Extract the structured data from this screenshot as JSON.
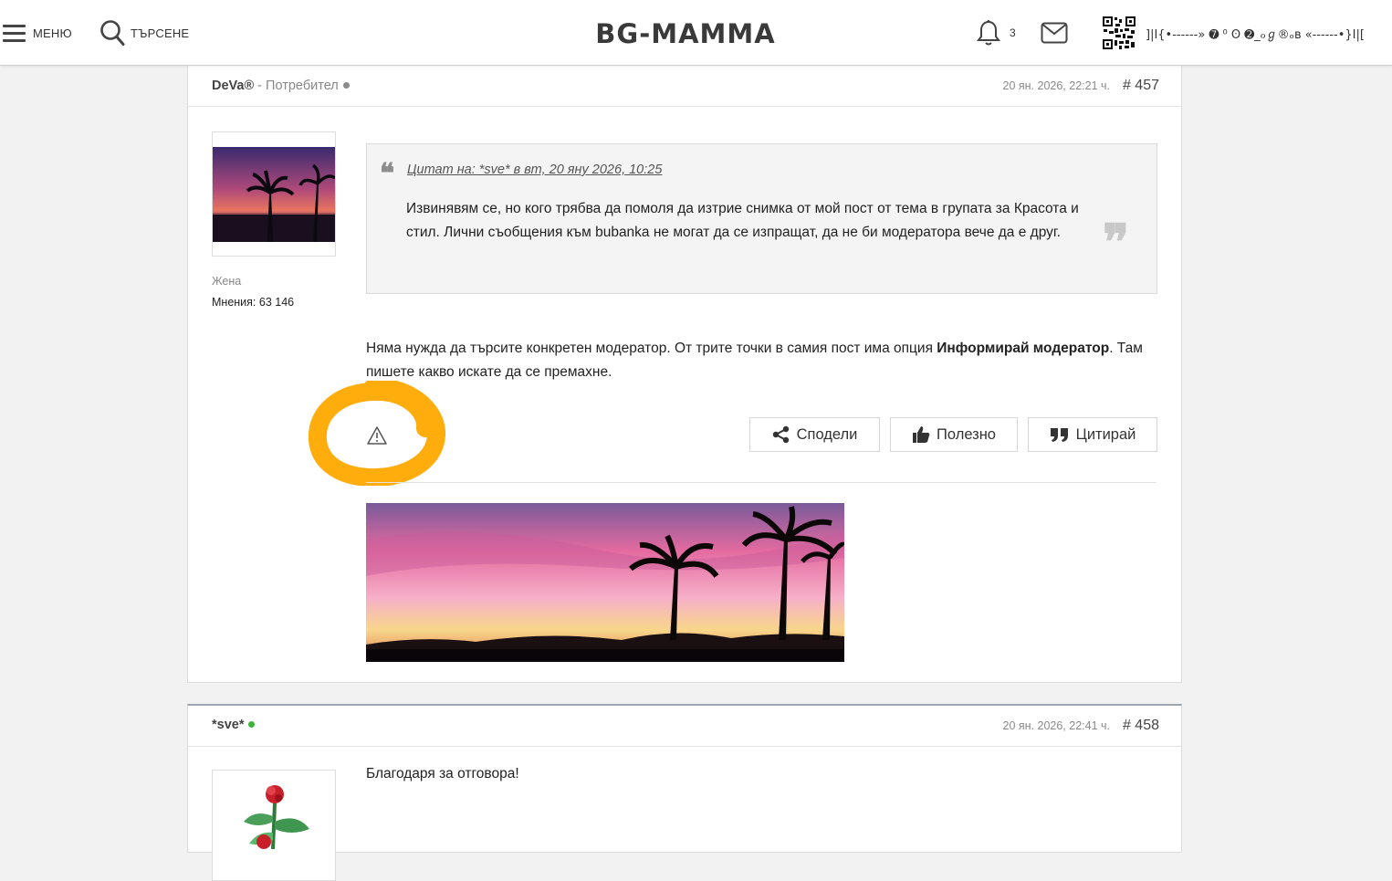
{
  "header": {
    "menu_label": "МЕНЮ",
    "search_label": "ТЪРСЕНЕ",
    "logo": "BG-MAMMA",
    "notifications_count": "3",
    "username": "]|I{•------» ➐ ⁰ ʘ ➋_ℴℊ®ₒʙ «------•}I|["
  },
  "post1": {
    "author": "DeVa®",
    "role": " - Потребител",
    "date": "20 ян. 2026, 22:21 ч.",
    "number": "# 457",
    "gender": "Жена",
    "opinions": "Мнения: 63 146",
    "quote": {
      "cite": "Цитат на: *sve* в вт, 20 яну 2026, 10:25",
      "text": "Извинявям се, но кого трябва да помоля да изтрие снимка от мой пост от тема в групата за Красота и стил. Лични съобщения към bubanka не могат да се изпращат, да не би модератора вече да е друг."
    },
    "body_before": "Няма нужда да търсите конкретен модератор. От трите точки в самия пост има опция ",
    "body_bold": "Информирай модератор",
    "body_after": ". Там пишете какво искате да се премахне.",
    "actions": {
      "share": "Сподели",
      "useful": "Полезно",
      "quote": "Цитирай"
    }
  },
  "post2": {
    "author": "*sve*",
    "date": "20 ян. 2026, 22:41 ч.",
    "number": "# 458",
    "text": "Благодаря за отговора!"
  },
  "colors": {
    "highlight_circle": "#ffad0d",
    "online_dot": "#3cb43c",
    "offline_dot": "#8a8a8a"
  }
}
